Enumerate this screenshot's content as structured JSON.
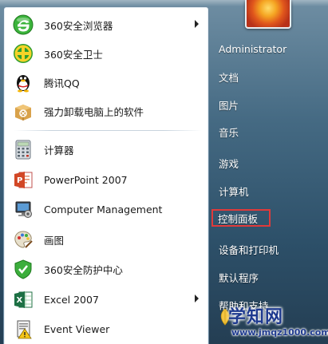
{
  "start_menu": {
    "programs": [
      {
        "label": "360安全浏览器",
        "icon": "360-browser-icon",
        "has_arrow": true
      },
      {
        "label": "360安全卫士",
        "icon": "360-safeguard-icon",
        "has_arrow": false
      },
      {
        "label": "腾讯QQ",
        "icon": "qq-penguin-icon",
        "has_arrow": false
      },
      {
        "label": "强力卸载电脑上的软件",
        "icon": "uninstall-box-icon",
        "has_arrow": false
      },
      {
        "label": "计算器",
        "icon": "calculator-icon",
        "has_arrow": false
      },
      {
        "label": "PowerPoint 2007",
        "icon": "powerpoint-icon",
        "has_arrow": false
      },
      {
        "label": "Computer Management",
        "icon": "computer-management-icon",
        "has_arrow": false
      },
      {
        "label": "画图",
        "icon": "paint-palette-icon",
        "has_arrow": false
      },
      {
        "label": "360安全防护中心",
        "icon": "360-protection-center-icon",
        "has_arrow": false
      },
      {
        "label": "Excel 2007",
        "icon": "excel-icon",
        "has_arrow": true
      },
      {
        "label": "Event Viewer",
        "icon": "event-viewer-icon",
        "has_arrow": false
      }
    ],
    "right": {
      "user_name": "Administrator",
      "documents": "文档",
      "pictures": "图片",
      "music": "音乐",
      "games": "游戏",
      "computer": "计算机",
      "control_panel": "控制面板",
      "devices_printers": "设备和打印机",
      "default_programs": "默认程序",
      "help_support": "帮助和支持"
    }
  },
  "watermark": {
    "title": "学知网",
    "url": "www.jmqz1000.com"
  },
  "colors": {
    "highlight_border": "#e03a3a",
    "watermark_text": "#1e3a8f"
  }
}
